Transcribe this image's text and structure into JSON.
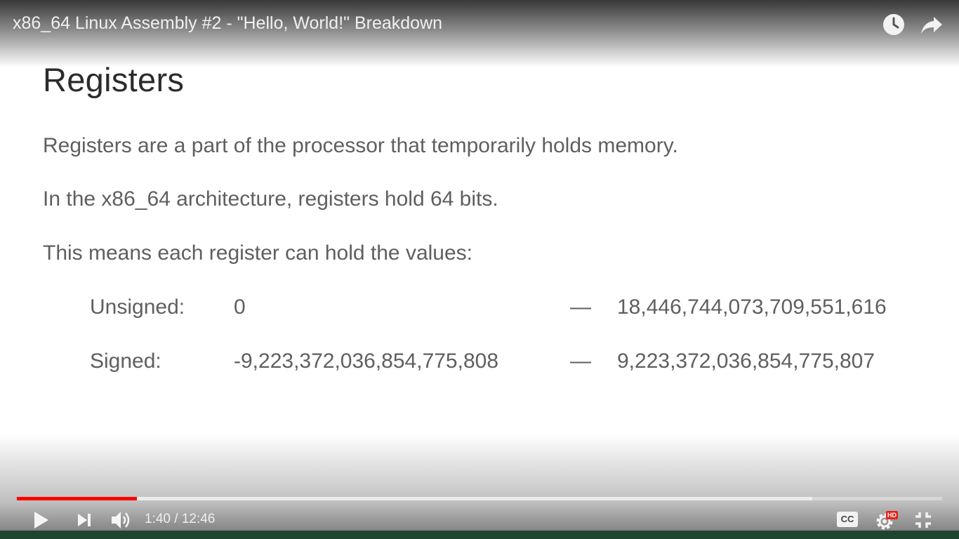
{
  "player": {
    "title": "x86_64 Linux Assembly #2 - \"Hello, World!\" Breakdown",
    "top_icons": [
      "clock-icon",
      "share-icon"
    ],
    "current_time": "1:40",
    "separator": " / ",
    "duration": "12:46",
    "progress_played_fraction": 0.13,
    "progress_loaded_fraction": 0.86,
    "accent_color": "#ff0000",
    "hd_badge": "HD",
    "cc_label": "CC",
    "controls": [
      "play-icon",
      "next-icon",
      "volume-icon",
      "cc-icon",
      "settings-icon",
      "exit-fullscreen-icon"
    ]
  },
  "slide": {
    "heading": "Registers",
    "lines": [
      "Registers are a part of the processor that temporarily holds memory.",
      "In the x86_64 architecture, registers hold 64 bits.",
      "This means each register can hold the values:"
    ],
    "ranges": [
      {
        "label": "Unsigned:",
        "min": "0",
        "dash": "—",
        "max": "18,446,744,073,709,551,616"
      },
      {
        "label": "Signed:",
        "min": "-9,223,372,036,854,775,808",
        "dash": "—",
        "max": "9,223,372,036,854,775,807"
      }
    ]
  }
}
